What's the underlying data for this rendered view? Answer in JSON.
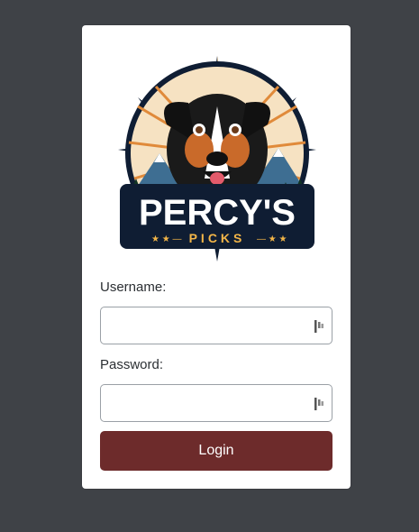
{
  "logo": {
    "brand_name": "PERCY'S",
    "brand_sub": "PICKS"
  },
  "form": {
    "username_label": "Username:",
    "username_value": "",
    "password_label": "Password:",
    "password_value": "",
    "login_label": "Login"
  },
  "icons": {
    "field_icon": "password-manager-icon"
  },
  "colors": {
    "page_background": "#3f4247",
    "card_background": "#ffffff",
    "login_button": "#6d2b2b",
    "logo_navy": "#0f1d33",
    "logo_gold": "#f2b548"
  }
}
